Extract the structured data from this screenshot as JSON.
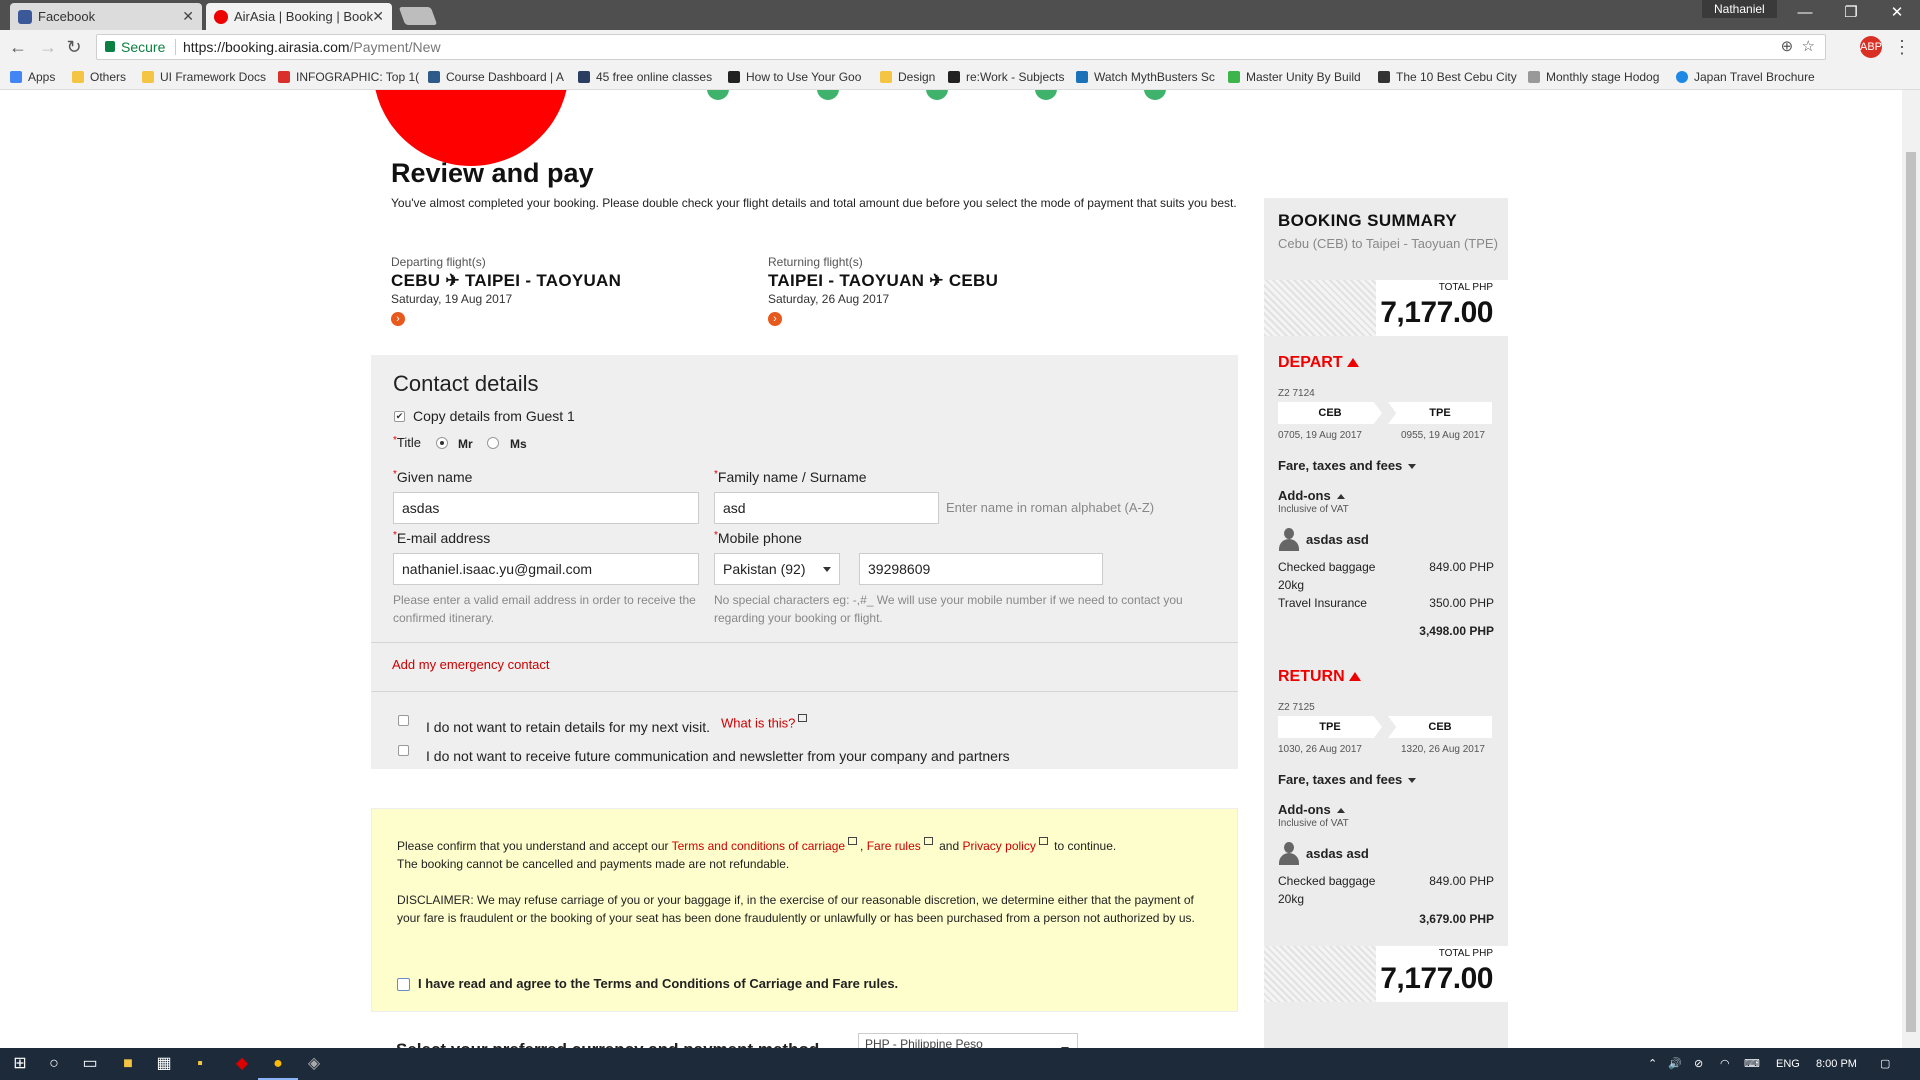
{
  "browser": {
    "tabs": [
      {
        "title": "Facebook",
        "active": false,
        "icon": "facebook-icon",
        "color": "#3b5998"
      },
      {
        "title": "AirAsia | Booking | Book",
        "active": true,
        "icon": "airasia-icon",
        "color": "#e00"
      }
    ],
    "profile": "Nathaniel",
    "secure_label": "Secure",
    "url_host": "https://booking.airasia.com",
    "url_path": "/Payment/New",
    "bookmarks": [
      {
        "label": "Apps",
        "icon": "apps-icon",
        "color": "#4285f4"
      },
      {
        "label": "Others",
        "icon": "folder-icon",
        "color": "#f4c542"
      },
      {
        "label": "UI Framework Docs",
        "icon": "folder-icon",
        "color": "#f4c542"
      },
      {
        "label": "INFOGRAPHIC: Top 1(",
        "icon": "infographic-icon",
        "color": "#d9302c"
      },
      {
        "label": "Course Dashboard | A",
        "icon": "course-icon",
        "color": "#2d5a88"
      },
      {
        "label": "45 free online classes",
        "icon": "bookmark-icon",
        "color": "#2b3d60"
      },
      {
        "label": "How to Use Your Goo",
        "icon": "htg-icon",
        "color": "#222"
      },
      {
        "label": "Design",
        "icon": "folder-icon",
        "color": "#f4c542"
      },
      {
        "label": "re:Work - Subjects",
        "icon": "rework-icon",
        "color": "#222"
      },
      {
        "label": "Watch MythBusters Sc",
        "icon": "cube-icon",
        "color": "#1a73b8"
      },
      {
        "label": "Master Unity By Build",
        "icon": "udemy-icon",
        "color": "#3db54a"
      },
      {
        "label": "The 10 Best Cebu City",
        "icon": "tripadvisor-icon",
        "color": "#333"
      },
      {
        "label": "Monthly stage Hodog",
        "icon": "page-icon",
        "color": "#999"
      },
      {
        "label": "Japan Travel Brochure",
        "icon": "globe-icon",
        "color": "#1e88e5"
      }
    ]
  },
  "page": {
    "title": "Review and pay",
    "intro": "You've almost completed your booking. Please double check your flight details and total amount due before you select the mode of payment that suits you best.",
    "departing": {
      "label": "Departing flight(s)",
      "from": "CEBU",
      "to": "TAIPEI - TAOYUAN",
      "date": "Saturday, 19 Aug 2017"
    },
    "returning": {
      "label": "Returning flight(s)",
      "from": "TAIPEI - TAOYUAN",
      "to": "CEBU",
      "date": "Saturday, 26 Aug 2017"
    }
  },
  "contact": {
    "heading": "Contact details",
    "copy_label": "Copy details from Guest 1",
    "copy_checked": true,
    "title_label": "Title",
    "title_options": [
      "Mr",
      "Ms"
    ],
    "title_selected": "Mr",
    "given_name_label": "Given name",
    "given_name_value": "asdas",
    "family_name_label": "Family name / Surname",
    "family_name_value": "asd",
    "name_hint": "Enter name in roman alphabet (A-Z)",
    "email_label": "E-mail address",
    "email_value": "nathaniel.isaac.yu@gmail.com",
    "email_hint": "Please enter a valid email address in order to receive the confirmed itinerary.",
    "phone_label": "Mobile phone",
    "phone_country": "Pakistan (92)",
    "phone_value": "39298609",
    "phone_hint": "No special characters eg: -,#_ We will use your mobile number if we need to contact you regarding your booking or flight.",
    "emergency_link": "Add my emergency contact",
    "opt_retain": "I do not want to retain details for my next visit.",
    "what_is_this": "What is this?",
    "opt_newsletter": "I do not want to receive future communication and newsletter from your company and partners"
  },
  "terms": {
    "p1_a": "Please confirm that you understand and accept our",
    "link_terms": "Terms and conditions of carriage",
    "link_fare": "Fare rules",
    "and": "and",
    "link_privacy": "Privacy policy",
    "p1_b": "to continue.",
    "p1_c": "The booking cannot be cancelled and payments made are not refundable.",
    "disclaimer": "DISCLAIMER: We may refuse carriage of you or your baggage if, in the exercise of our reasonable discretion, we determine either that the payment of your fare is fraudulent or the booking of your seat has been done fraudulently or unlawfully or has been purchased from a person not authorized by us.",
    "agree_label": "I have read and agree to the Terms and Conditions of Carriage and Fare rules."
  },
  "payment": {
    "heading": "Select your preferred currency and payment method",
    "currency": "PHP - Philippine Peso"
  },
  "summary": {
    "heading": "BOOKING SUMMARY",
    "route": "Cebu (CEB) to Taipei - Taoyuan (TPE)",
    "total_label": "TOTAL PHP",
    "total_value": "7,177.00",
    "depart": {
      "label": "DEPART",
      "flight_no": "Z2 7124",
      "from": "CEB",
      "to": "TPE",
      "from_time": "0705, 19 Aug 2017",
      "to_time": "0955, 19 Aug 2017",
      "fare_label": "Fare, taxes and fees",
      "addons_label": "Add-ons",
      "vat": "Inclusive of VAT",
      "guest": "asdas asd",
      "items": [
        {
          "name": "Checked baggage 20kg",
          "value": "849.00 PHP"
        },
        {
          "name": "Travel Insurance",
          "value": "350.00 PHP"
        }
      ],
      "subtotal": "3,498.00 PHP"
    },
    "return": {
      "label": "RETURN",
      "flight_no": "Z2 7125",
      "from": "TPE",
      "to": "CEB",
      "from_time": "1030, 26 Aug 2017",
      "to_time": "1320, 26 Aug 2017",
      "fare_label": "Fare, taxes and fees",
      "addons_label": "Add-ons",
      "vat": "Inclusive of VAT",
      "guest": "asdas asd",
      "items": [
        {
          "name": "Checked baggage 20kg",
          "value": "849.00 PHP"
        }
      ],
      "subtotal": "3,679.00 PHP"
    }
  },
  "taskbar": {
    "lang": "ENG",
    "time": "8:00 PM"
  }
}
